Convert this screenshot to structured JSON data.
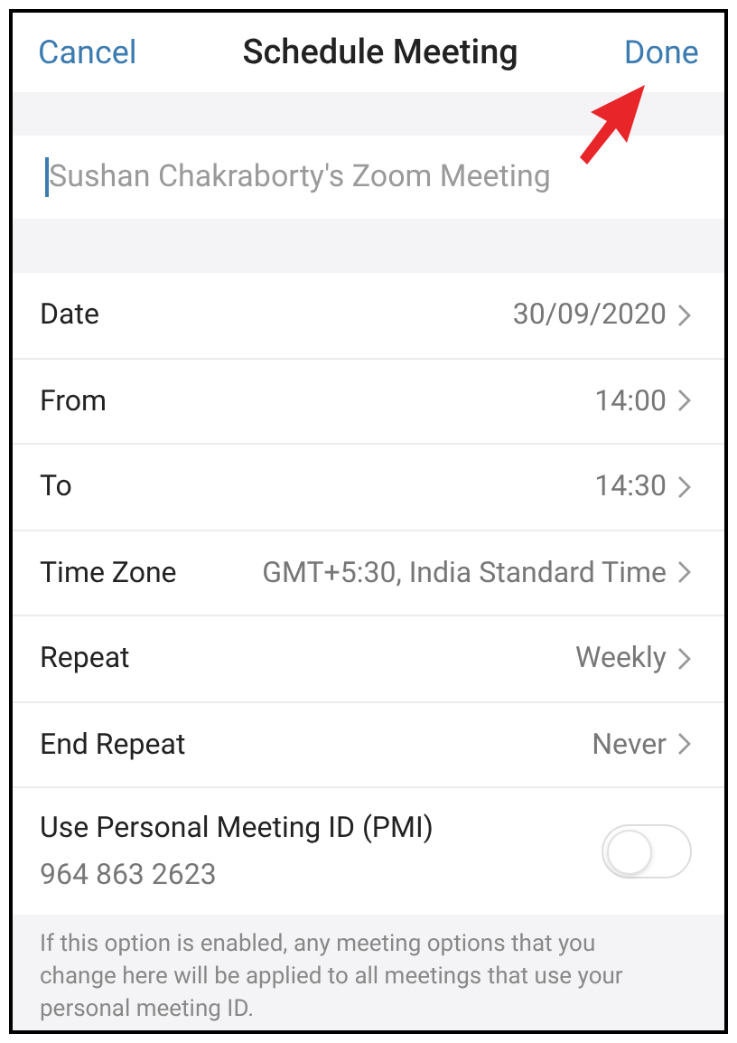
{
  "header": {
    "cancel": "Cancel",
    "title": "Schedule Meeting",
    "done": "Done"
  },
  "topic": {
    "placeholder": "Sushan Chakraborty's Zoom Meeting"
  },
  "rows": [
    {
      "label": "Date",
      "value": "30/09/2020"
    },
    {
      "label": "From",
      "value": "14:00"
    },
    {
      "label": "To",
      "value": "14:30"
    },
    {
      "label": "Time Zone",
      "value": "GMT+5:30, India Standard Time"
    },
    {
      "label": "Repeat",
      "value": "Weekly"
    },
    {
      "label": "End Repeat",
      "value": "Never"
    }
  ],
  "pmi": {
    "label": "Use Personal Meeting ID (PMI)",
    "id": "964 863 2623",
    "on": false
  },
  "note": "If this option is enabled, any meeting options that you change here will be applied to all meetings that use your personal meeting ID."
}
